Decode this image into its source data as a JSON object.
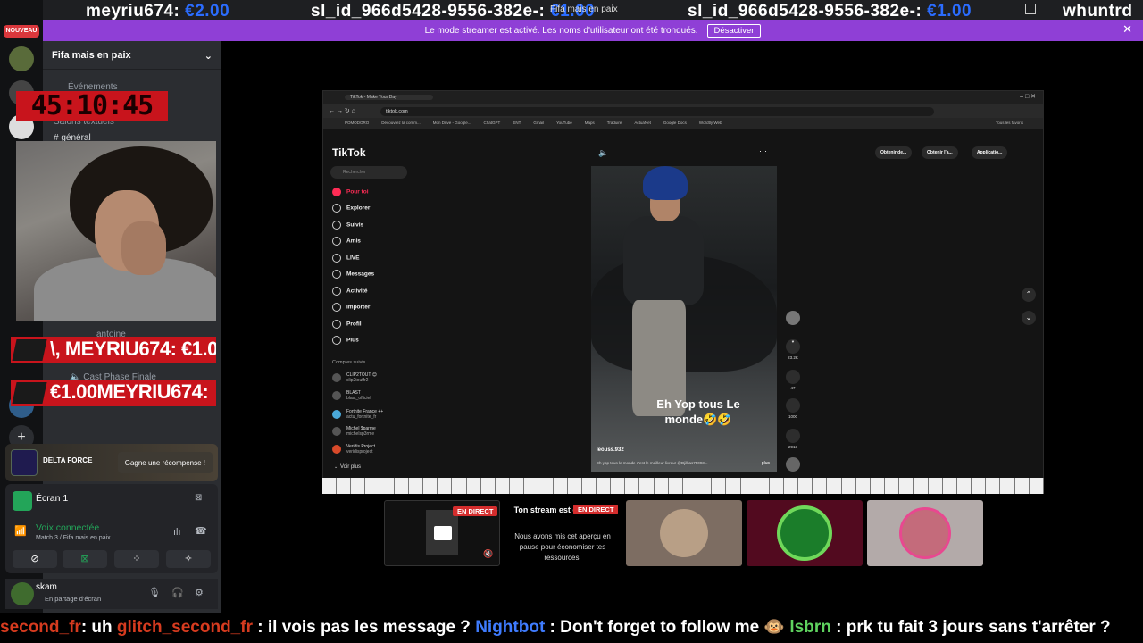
{
  "top_overlay": {
    "donations": [
      {
        "name": "meyriu674:",
        "amount": "€2.00"
      },
      {
        "name": "sl_id_966d5428-9556-382e-:",
        "amount": "€1.00"
      },
      {
        "name": "sl_id_966d5428-9556-382e-:",
        "amount": "€1.00"
      },
      {
        "name": "whuntrd",
        "amount": ""
      }
    ],
    "window_title": "Fifa mais en paix"
  },
  "rail": {
    "badge": "NOUVEAU"
  },
  "banner": {
    "text": "Le mode streamer est activé. Les noms d'utilisateur ont été tronqués.",
    "button": "Désactiver",
    "close": "✕"
  },
  "channels": {
    "server_name": "Fifa mais en paix",
    "events": "Événements",
    "text_section": "Salons textuels",
    "general": "général",
    "member": "antoine",
    "voice_channel": "Cast Phase Finale"
  },
  "timer": "45:10:45",
  "strips": [
    "\\, MEYRIU674: €1.00",
    "€1.00MEYRIU674:"
  ],
  "delta_card": {
    "name": "DELTA FORCE",
    "button": "Gagne une récompense !"
  },
  "voice_panel": {
    "screen": "Écran 1",
    "status": "Voix connectée",
    "sub": "Match 3 / Fifa mais en paix"
  },
  "user_panel": {
    "name": "skam",
    "status": "En partage d'écran"
  },
  "browser": {
    "tab": "TikTok - Make Your Day",
    "url": "tiktok.com",
    "bookmarks": [
      "POMODORO",
      "Découvrez la comm...",
      "Mon Drive - Google...",
      "ChatGPT",
      "ENT",
      "Gmail",
      "YouTube",
      "Maps",
      "Traduire",
      "ActuaNet",
      "Google Docs",
      "Wordtly Web"
    ],
    "bookmarks_right": "Tous les favoris",
    "logo": "TikTok",
    "search": "Rechercher",
    "nav": [
      "Pour toi",
      "Explorer",
      "Suivis",
      "Amis",
      "LIVE",
      "Messages",
      "Activité",
      "Importer",
      "Profil",
      "Plus"
    ],
    "followed_title": "Comptes suivis",
    "followed": [
      {
        "name": "CLIP2TOUT 😊",
        "handle": "clip2toutfr2"
      },
      {
        "name": "BLAST",
        "handle": "blast_officiel"
      },
      {
        "name": "Fortnite France ++",
        "handle": "actu_fortnite_fr"
      },
      {
        "name": "Michel $parme",
        "handle": "michelsp3rme"
      },
      {
        "name": "Veridis Project",
        "handle": "veridisproject"
      }
    ],
    "see_more": "Voir plus",
    "top_buttons": [
      "Obtenir de...",
      "Obtenir l'a...",
      "Applicatio..."
    ],
    "video": {
      "caption": "Eh Yop tous Le monde🤣🤣",
      "author": "leouss.932",
      "desc": "Eh yop tous le monde c'est le meilleur livreur @Djilkas75093...",
      "more": "plus",
      "likes": "23.2K",
      "comments": "47",
      "saves": "1000",
      "shares": "2913"
    }
  },
  "thumbs": {
    "live": "EN DIRECT",
    "message_title": "Ton stream est  en cours !",
    "message_sub": "Nous avons mis cet aperçu en pause pour économiser tes ressources."
  },
  "ticker": [
    {
      "user": "second_fr",
      "msg": ": uh  "
    },
    {
      "user": "glitch_second_fr",
      "msg": " : il vois pas les message ? "
    },
    {
      "user": "Nightbot",
      "msg": " : Don't forget to follow me 🐵 "
    },
    {
      "user": "lsbrn",
      "msg": " : prk tu fait 3 jours sans t'arrêter ?"
    }
  ]
}
